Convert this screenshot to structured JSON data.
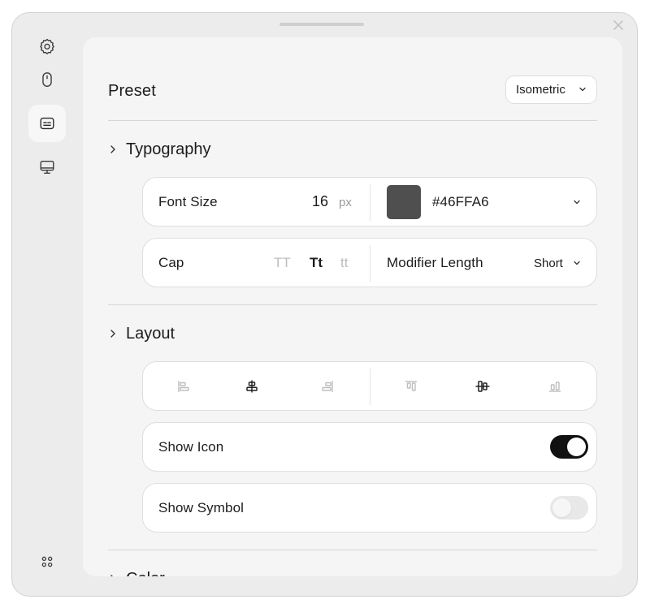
{
  "sidebar": {
    "items": [
      {
        "icon": "gear-icon"
      },
      {
        "icon": "mouse-icon"
      },
      {
        "icon": "captions-icon",
        "active": true
      },
      {
        "icon": "monitor-icon"
      }
    ],
    "bottom_icon": "apps-grid-icon"
  },
  "preset": {
    "title": "Preset",
    "selected": "Isometric"
  },
  "typography": {
    "title": "Typography",
    "font_size_label": "Font Size",
    "font_size_value": "16",
    "font_size_unit": "px",
    "color_value": "#46FFA6",
    "swatch_color": "#4f4f4f",
    "cap_label": "Cap",
    "cap_options": [
      "TT",
      "Tt",
      "tt"
    ],
    "cap_selected": "Tt",
    "modifier_label": "Modifier Length",
    "modifier_value": "Short"
  },
  "layout": {
    "title": "Layout",
    "alignments": [
      "align-left-icon",
      "align-center-horizontal-icon",
      "align-right-icon",
      "align-top-icon",
      "align-center-vertical-icon",
      "align-bottom-icon"
    ],
    "selected_horizontal": "align-center-horizontal-icon",
    "selected_vertical": "align-center-vertical-icon",
    "show_icon_label": "Show Icon",
    "show_icon": true,
    "show_symbol_label": "Show Symbol",
    "show_symbol": false
  },
  "color": {
    "title": "Color"
  }
}
